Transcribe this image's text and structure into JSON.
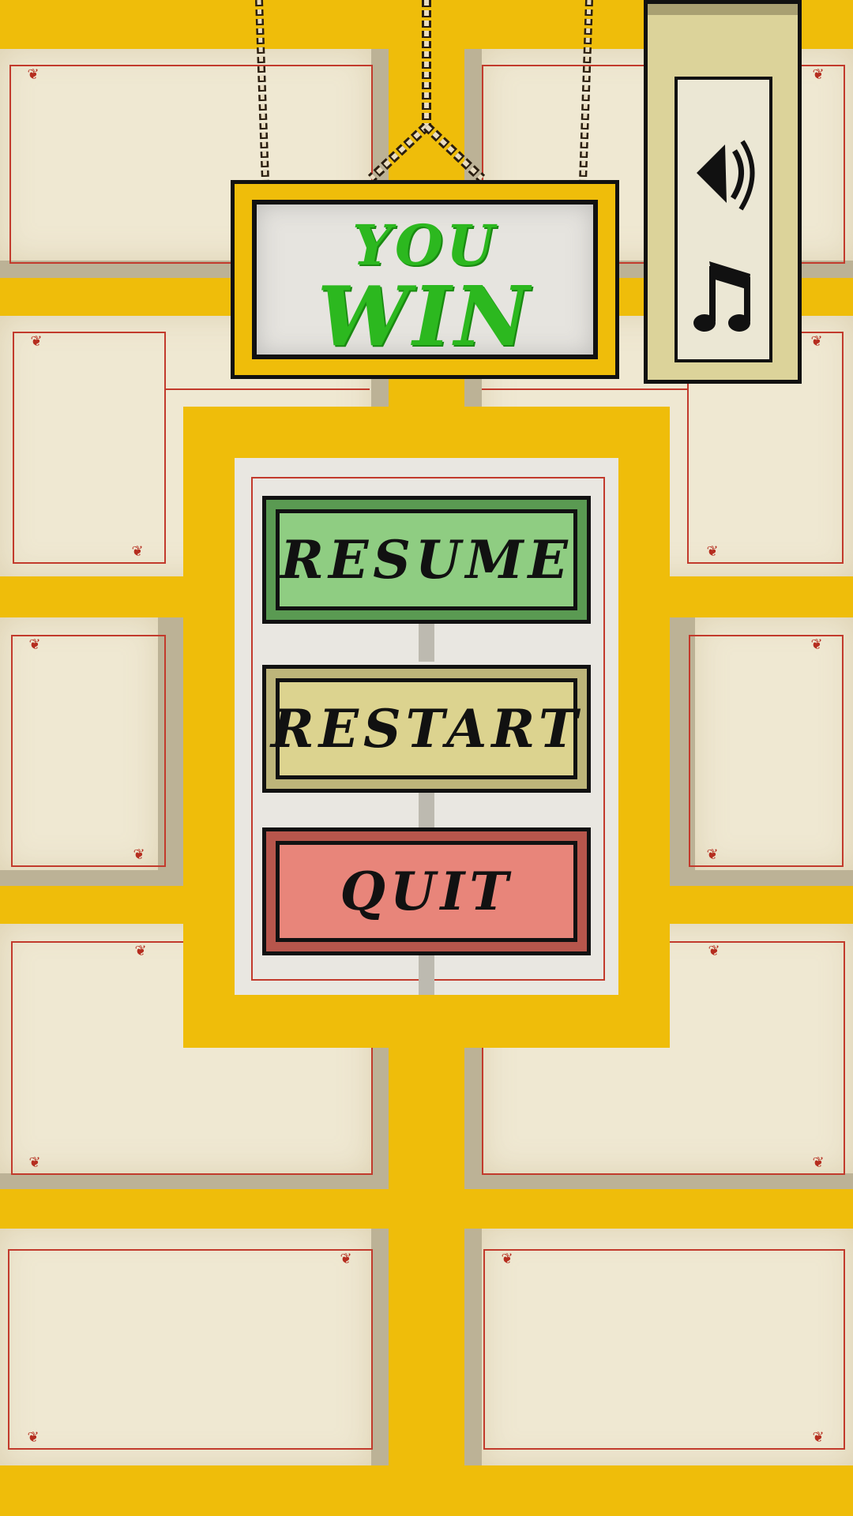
{
  "title": {
    "line1": "YOU",
    "line2": "WIN"
  },
  "settings": {
    "sound_icon": "speaker-icon",
    "music_icon": "music-note-icon"
  },
  "menu": {
    "resume_label": "RESUME",
    "restart_label": "RESTART",
    "quit_label": "QUIT"
  },
  "colors": {
    "background_yellow": "#efbd0a",
    "title_green": "#2cb81f",
    "resume_green": "#8fcd82",
    "restart_khaki": "#dcd38f",
    "quit_red": "#e8857a",
    "frame_red": "#c23a2c"
  }
}
